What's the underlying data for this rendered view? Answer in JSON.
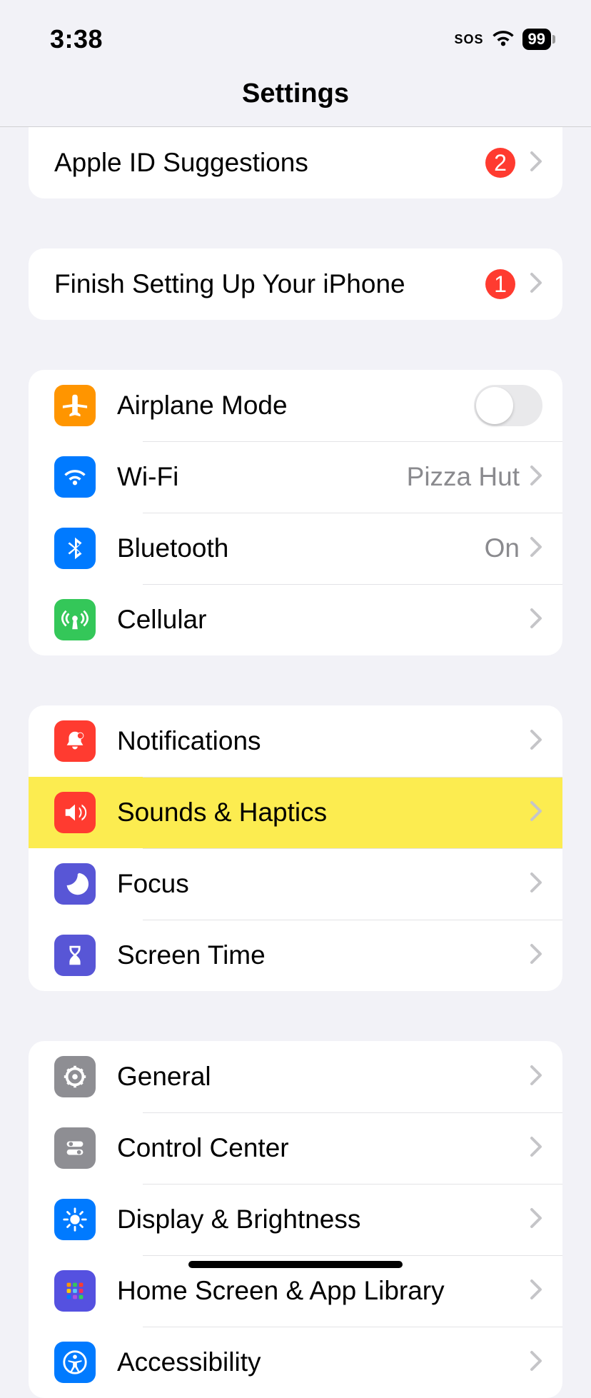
{
  "status": {
    "time": "3:38",
    "sos": "SOS",
    "battery": "99"
  },
  "title": "Settings",
  "group0": {
    "apple_id_suggestions": {
      "label": "Apple ID Suggestions",
      "badge": "2"
    }
  },
  "group1": {
    "finish_setup": {
      "label": "Finish Setting Up Your iPhone",
      "badge": "1"
    }
  },
  "group2": {
    "airplane": {
      "label": "Airplane Mode"
    },
    "wifi": {
      "label": "Wi-Fi",
      "detail": "Pizza Hut"
    },
    "bluetooth": {
      "label": "Bluetooth",
      "detail": "On"
    },
    "cellular": {
      "label": "Cellular"
    }
  },
  "group3": {
    "notifications": {
      "label": "Notifications"
    },
    "sounds": {
      "label": "Sounds & Haptics"
    },
    "focus": {
      "label": "Focus"
    },
    "screentime": {
      "label": "Screen Time"
    }
  },
  "group4": {
    "general": {
      "label": "General"
    },
    "control_center": {
      "label": "Control Center"
    },
    "display": {
      "label": "Display & Brightness"
    },
    "home_screen": {
      "label": "Home Screen & App Library"
    },
    "accessibility": {
      "label": "Accessibility"
    }
  }
}
